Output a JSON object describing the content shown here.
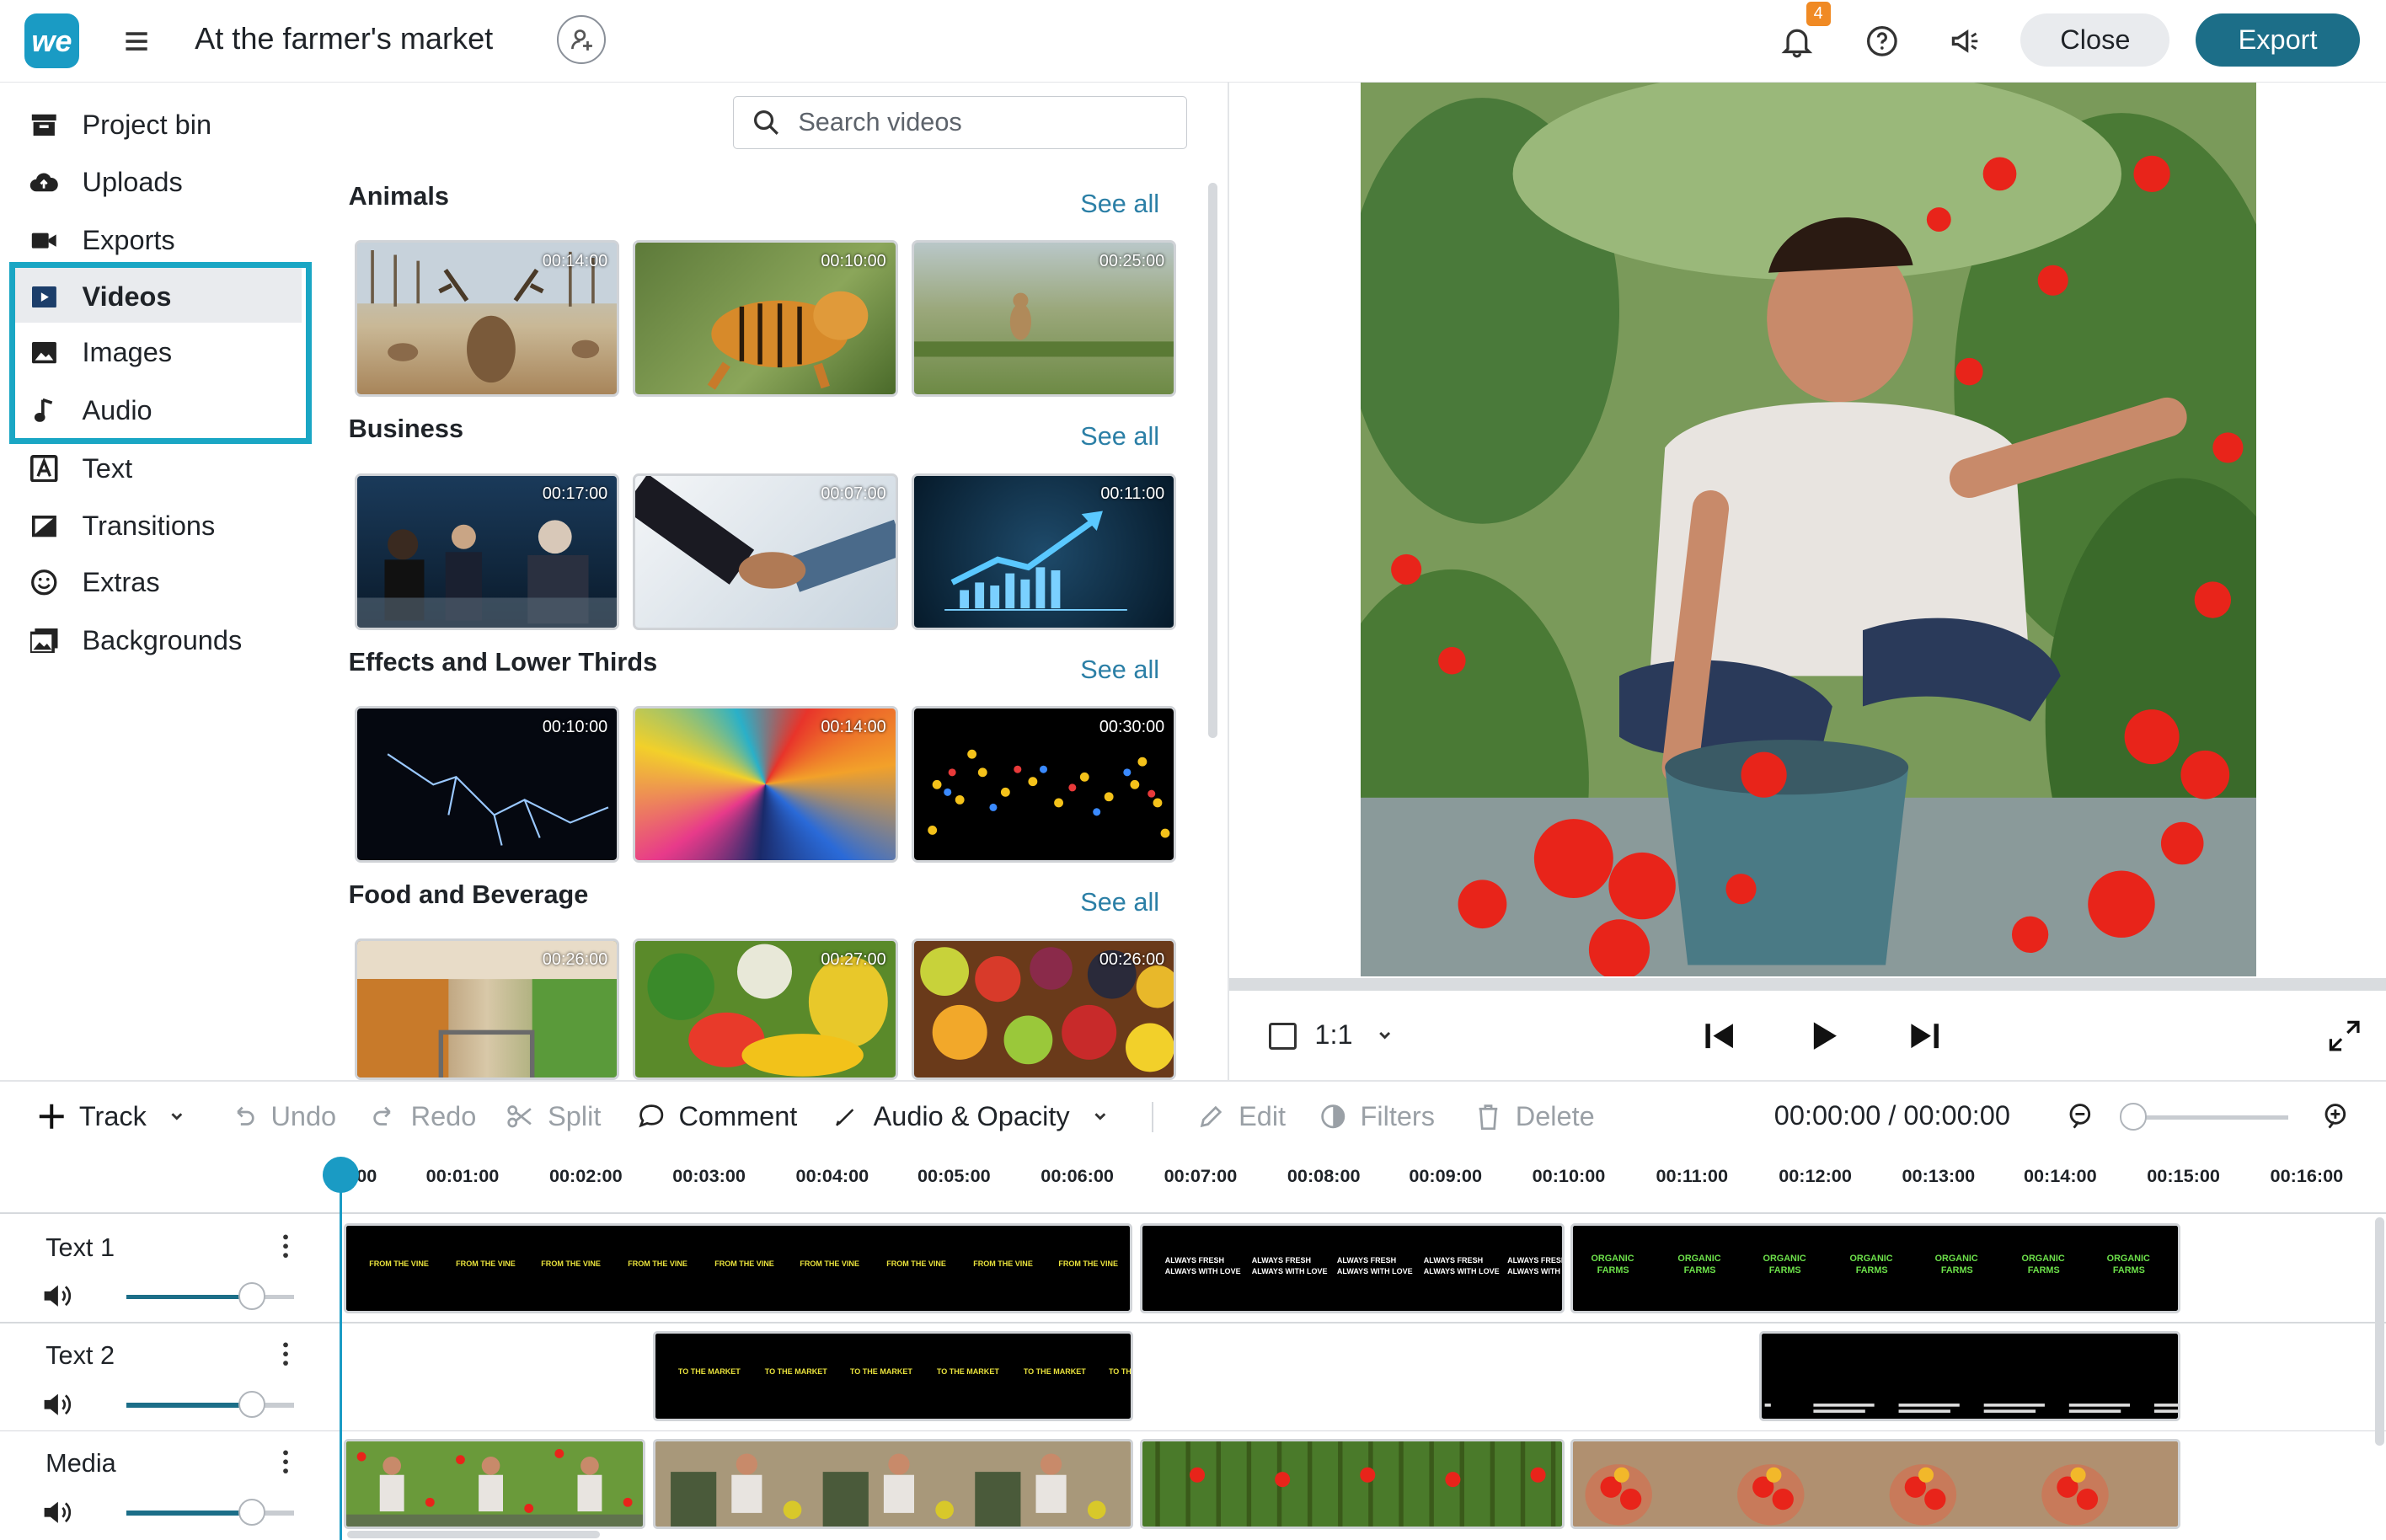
{
  "header": {
    "logo_text": "we",
    "project_title": "At the farmer's market",
    "notification_count": "4",
    "close_label": "Close",
    "export_label": "Export",
    "accent_color": "#1c6e88",
    "brand_color": "#1a9bc4"
  },
  "sidebar": {
    "items": [
      {
        "label": "Project bin",
        "icon": "archive-icon"
      },
      {
        "label": "Uploads",
        "icon": "cloud-upload-icon"
      },
      {
        "label": "Exports",
        "icon": "camera-icon"
      },
      {
        "label": "Videos",
        "icon": "video-icon",
        "active": true
      },
      {
        "label": "Images",
        "icon": "image-icon"
      },
      {
        "label": "Audio",
        "icon": "music-note-icon"
      },
      {
        "label": "Text",
        "icon": "text-icon"
      },
      {
        "label": "Transitions",
        "icon": "transition-icon"
      },
      {
        "label": "Extras",
        "icon": "smiley-icon"
      },
      {
        "label": "Backgrounds",
        "icon": "backgrounds-icon"
      }
    ]
  },
  "library": {
    "search_placeholder": "Search videos",
    "see_all": "See all",
    "categories": [
      {
        "title": "Animals",
        "durations": [
          "00:14:00",
          "00:10:00",
          "00:25:00"
        ]
      },
      {
        "title": "Business",
        "durations": [
          "00:17:00",
          "00:07:00",
          "00:11:00"
        ]
      },
      {
        "title": "Effects and Lower Thirds",
        "durations": [
          "00:10:00",
          "00:14:00",
          "00:30:00"
        ]
      },
      {
        "title": "Food and Beverage",
        "durations": [
          "00:26:00",
          "00:27:00",
          "00:26:00"
        ]
      }
    ]
  },
  "preview": {
    "aspect_ratio": "1:1"
  },
  "toolbar": {
    "track": "Track",
    "undo": "Undo",
    "redo": "Redo",
    "split": "Split",
    "comment": "Comment",
    "audio_opacity": "Audio & Opacity",
    "edit": "Edit",
    "filters": "Filters",
    "delete": "Delete",
    "time": "00:00:00 / 00:00:00"
  },
  "ruler": {
    "ticks": [
      "00",
      "00:01:00",
      "00:02:00",
      "00:03:00",
      "00:04:00",
      "00:05:00",
      "00:06:00",
      "00:07:00",
      "00:08:00",
      "00:09:00",
      "00:10:00",
      "00:11:00",
      "00:12:00",
      "00:13:00",
      "00:14:00",
      "00:15:00",
      "00:16:00"
    ]
  },
  "tracks": [
    {
      "name": "Text 1",
      "volume": 0.75
    },
    {
      "name": "Text 2",
      "volume": 0.75
    },
    {
      "name": "Media",
      "volume": 0.75
    }
  ],
  "clips": {
    "text1_a": "FROM THE VINE",
    "text1_b_line1": "ALWAYS FRESH",
    "text1_b_line2": "ALWAYS WITH LOVE",
    "text1_c_line1": "ORGANIC",
    "text1_c_line2": "FARMS",
    "text2_a": "TO THE MARKET"
  }
}
